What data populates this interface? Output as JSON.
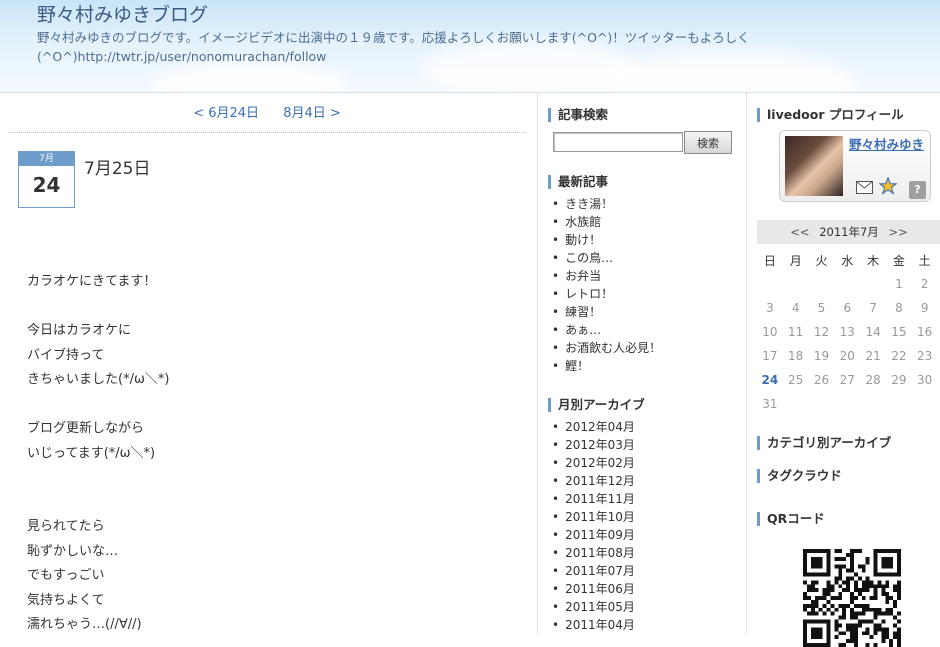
{
  "header": {
    "title": "野々村みゆきブログ",
    "description": "野々村みゆきのブログです。イメージビデオに出演中の１９歳です。応援よろしくお願いします(^O^)！ツイッターもよろしく(^O^)http://twtr.jp/user/nonomurachan/follow"
  },
  "pager": {
    "prev": "< 6月24日",
    "next": "8月4日 >"
  },
  "entry": {
    "month": "7月",
    "day": "24",
    "title": "7月25日",
    "lines": [
      "カラオケにきてます！",
      "",
      "今日はカラオケに",
      "バイブ持って",
      "きちゃいました(*/ω＼*)",
      "",
      "ブログ更新しながら",
      "いじってます(*/ω＼*)",
      "",
      "",
      "見られてたら",
      "恥ずかしいな…",
      "でもすっごい",
      "気持ちよくて",
      "濡れちゃう…(//∀//)"
    ]
  },
  "search": {
    "title": "記事検索",
    "button": "検索",
    "value": ""
  },
  "recent": {
    "title": "最新記事",
    "items": [
      "きき湯！",
      "水族館",
      "動け！",
      "この鳥…",
      "お弁当",
      "レトロ！",
      "練習！",
      "あぁ…",
      "お酒飲む人必見！",
      "鰹！"
    ]
  },
  "archive": {
    "title": "月別アーカイブ",
    "items": [
      "2012年04月",
      "2012年03月",
      "2012年02月",
      "2011年12月",
      "2011年11月",
      "2011年10月",
      "2011年09月",
      "2011年08月",
      "2011年07月",
      "2011年06月",
      "2011年05月",
      "2011年04月"
    ]
  },
  "profile": {
    "title": "livedoor プロフィール",
    "name": "野々村みゆき",
    "help": "?"
  },
  "calendar": {
    "prev": "<<",
    "month": "2011年7月",
    "next": ">>",
    "weekdays": [
      "日",
      "月",
      "火",
      "水",
      "木",
      "金",
      "土"
    ],
    "rows": [
      [
        "",
        "",
        "",
        "",
        "",
        "1",
        "2"
      ],
      [
        "3",
        "4",
        "5",
        "6",
        "7",
        "8",
        "9"
      ],
      [
        "10",
        "11",
        "12",
        "13",
        "14",
        "15",
        "16"
      ],
      [
        "17",
        "18",
        "19",
        "20",
        "21",
        "22",
        "23"
      ],
      [
        "24",
        "25",
        "26",
        "27",
        "28",
        "29",
        "30"
      ],
      [
        "31",
        "",
        "",
        "",
        "",
        "",
        ""
      ]
    ],
    "today": "24"
  },
  "sections": {
    "category": "カテゴリ別アーカイブ",
    "tagcloud": "タグクラウド",
    "qr": "QRコード"
  },
  "colors": {
    "accent": "#6e9ccb",
    "link": "#3b6fb5"
  }
}
